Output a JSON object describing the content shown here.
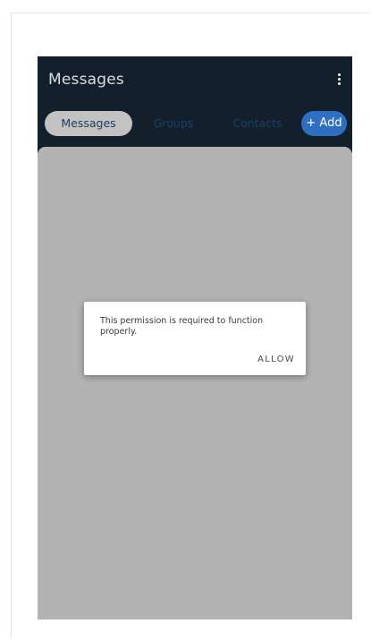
{
  "appbar": {
    "title": "Messages",
    "menu_icon": "more-vert-icon"
  },
  "tabs": [
    {
      "label": "Messages",
      "selected": true
    },
    {
      "label": "Groups",
      "selected": false
    },
    {
      "label": "Contacts",
      "selected": false
    }
  ],
  "add_button": {
    "label": "+ Add"
  },
  "dialog": {
    "message": "This permission is required to function properly.",
    "allow_label": "ALLOW"
  },
  "colors": {
    "appbar": "#13202c",
    "accent": "#2f6fc1",
    "scrim": "#b3b3b3",
    "tab_text": "#19406a"
  }
}
